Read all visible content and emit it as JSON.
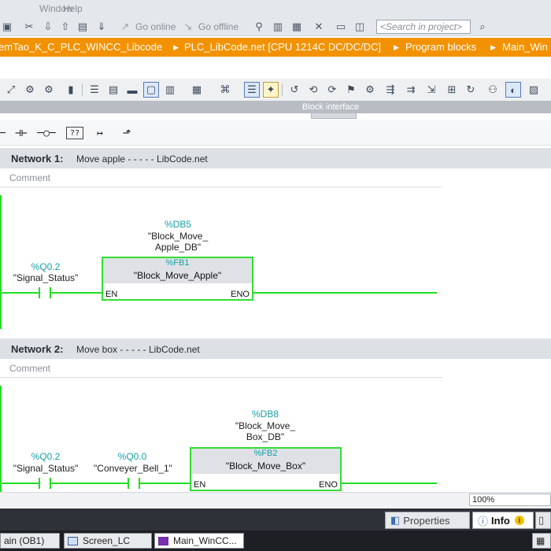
{
  "menu": {
    "window": "Window",
    "help": "Help"
  },
  "toolbar": {
    "go_online": "Go online",
    "go_offline": "Go offline",
    "search_placeholder": "<Search in project>"
  },
  "breadcrumb": [
    "emTao_K_C_PLC_WINCC_Libcode",
    "PLC_LibCode.net [CPU 1214C DC/DC/DC]",
    "Program blocks",
    "Main_Win"
  ],
  "block_interface": "Block interface",
  "networks": [
    {
      "title": "Network 1:",
      "description": "Move apple - - - - - LibCode.net",
      "comment": "Comment",
      "contacts": [
        {
          "address": "%Q0.2",
          "symbol": "\"Signal_Status\""
        }
      ],
      "block": {
        "db_address": "%DB5",
        "db_symbol_line1": "\"Block_Move_",
        "db_symbol_line2": "Apple_DB\"",
        "fb_type": "%FB1",
        "fb_name": "\"Block_Move_Apple\"",
        "en": "EN",
        "eno": "ENO"
      }
    },
    {
      "title": "Network 2:",
      "description": "Move box - - - - - LibCode.net",
      "comment": "Comment",
      "contacts": [
        {
          "address": "%Q0.2",
          "symbol": "\"Signal_Status\""
        },
        {
          "address": "%Q0.0",
          "symbol": "\"Conveyer_Bell_1\""
        }
      ],
      "block": {
        "db_address": "%DB8",
        "db_symbol_line1": "\"Block_Move_",
        "db_symbol_line2": "Box_DB\"",
        "fb_type": "%FB2",
        "fb_name": "\"Block_Move_Box\"",
        "en": "EN",
        "eno": "ENO"
      }
    }
  ],
  "zoom": "100%",
  "inspector_tabs": {
    "properties": "Properties",
    "info": "Info"
  },
  "taskbar": [
    "ain (OB1)",
    "Screen_LC",
    "Main_WinCC..."
  ],
  "colors": {
    "breadcrumb": "#f39200",
    "wire": "#22dd22",
    "address": "#17a0a6"
  }
}
